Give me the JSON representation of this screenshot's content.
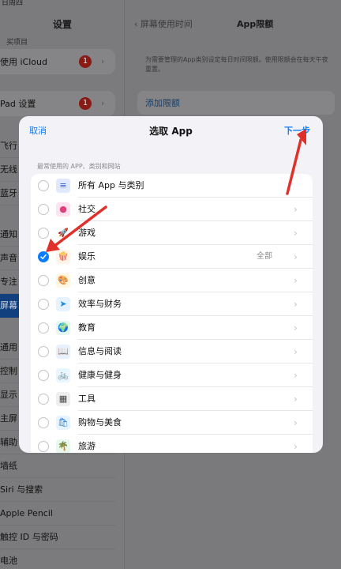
{
  "status": {
    "date_fragment": "日周四"
  },
  "sidebar": {
    "title": "设置",
    "subtitle": "买项目",
    "icloud": {
      "label": "使用 iCloud",
      "badge": "1"
    },
    "ipad": {
      "label": "Pad 设置",
      "badge": "1"
    },
    "items": [
      {
        "label": "飞行"
      },
      {
        "label": "无线"
      },
      {
        "label": "蓝牙"
      },
      {
        "label": "通知"
      },
      {
        "label": "声音"
      },
      {
        "label": "专注"
      },
      {
        "label": "屏幕"
      },
      {
        "label": "通用"
      },
      {
        "label": "控制"
      },
      {
        "label": "显示"
      },
      {
        "label": "主屏"
      },
      {
        "label": "辅助"
      },
      {
        "label": "墙纸"
      },
      {
        "label": "Siri 与搜索"
      },
      {
        "label": "Apple Pencil"
      },
      {
        "label": "触控 ID 与密码"
      },
      {
        "label": "电池"
      }
    ]
  },
  "main": {
    "back_label": "屏幕使用时间",
    "title": "App限额",
    "description": "为需要管理的App类别设定每日时间限额。使用限额会在每天午夜重置。",
    "add_link": "添加限额"
  },
  "modal": {
    "cancel": "取消",
    "title": "选取 App",
    "next": "下一步",
    "section_header": "最常使用的 APP、类别和网站",
    "rows": [
      {
        "label": "所有 App 与类别",
        "icon": "stack-icon",
        "glyph": "≡",
        "bg": "#dfe8ff",
        "fg": "#3c5bd6",
        "checked": false,
        "chevron": false,
        "extra": ""
      },
      {
        "label": "社交",
        "icon": "social-icon",
        "glyph": "●",
        "bg": "#ffe3ef",
        "fg": "#e0407a",
        "checked": false,
        "chevron": true,
        "extra": ""
      },
      {
        "label": "游戏",
        "icon": "rocket-icon",
        "glyph": "🚀",
        "bg": "#ffffff",
        "fg": "#555",
        "checked": false,
        "chevron": true,
        "extra": ""
      },
      {
        "label": "娱乐",
        "icon": "popcorn-icon",
        "glyph": "🍿",
        "bg": "#fff4e8",
        "fg": "#e04a2a",
        "checked": true,
        "chevron": true,
        "extra": "全部"
      },
      {
        "label": "创意",
        "icon": "palette-icon",
        "glyph": "🎨",
        "bg": "#fff6df",
        "fg": "#d99a1e",
        "checked": false,
        "chevron": true,
        "extra": ""
      },
      {
        "label": "效率与财务",
        "icon": "paper-plane-icon",
        "glyph": "➤",
        "bg": "#e6f2ff",
        "fg": "#1f8ae6",
        "checked": false,
        "chevron": true,
        "extra": ""
      },
      {
        "label": "教育",
        "icon": "globe-icon",
        "glyph": "🌍",
        "bg": "#e6f7ef",
        "fg": "#2c9a56",
        "checked": false,
        "chevron": true,
        "extra": ""
      },
      {
        "label": "信息与阅读",
        "icon": "book-icon",
        "glyph": "📖",
        "bg": "#e8f0fb",
        "fg": "#3c6fb5",
        "checked": false,
        "chevron": true,
        "extra": ""
      },
      {
        "label": "健康与健身",
        "icon": "bicycle-icon",
        "glyph": "🚲",
        "bg": "#e8f6ff",
        "fg": "#1f8ae6",
        "checked": false,
        "chevron": true,
        "extra": ""
      },
      {
        "label": "工具",
        "icon": "calculator-icon",
        "glyph": "▦",
        "bg": "#eeeeee",
        "fg": "#444",
        "checked": false,
        "chevron": true,
        "extra": ""
      },
      {
        "label": "购物与美食",
        "icon": "shopping-bag-icon",
        "glyph": "🛍",
        "bg": "#e7f3ff",
        "fg": "#2a7fd9",
        "checked": false,
        "chevron": true,
        "extra": ""
      },
      {
        "label": "旅游",
        "icon": "palm-tree-icon",
        "glyph": "🌴",
        "bg": "#e8f8ee",
        "fg": "#2c9a56",
        "checked": false,
        "chevron": true,
        "extra": ""
      }
    ]
  },
  "colors": {
    "accent": "#0a7cff",
    "annotation_arrow": "#e0302a",
    "badge": "#d0271d"
  }
}
